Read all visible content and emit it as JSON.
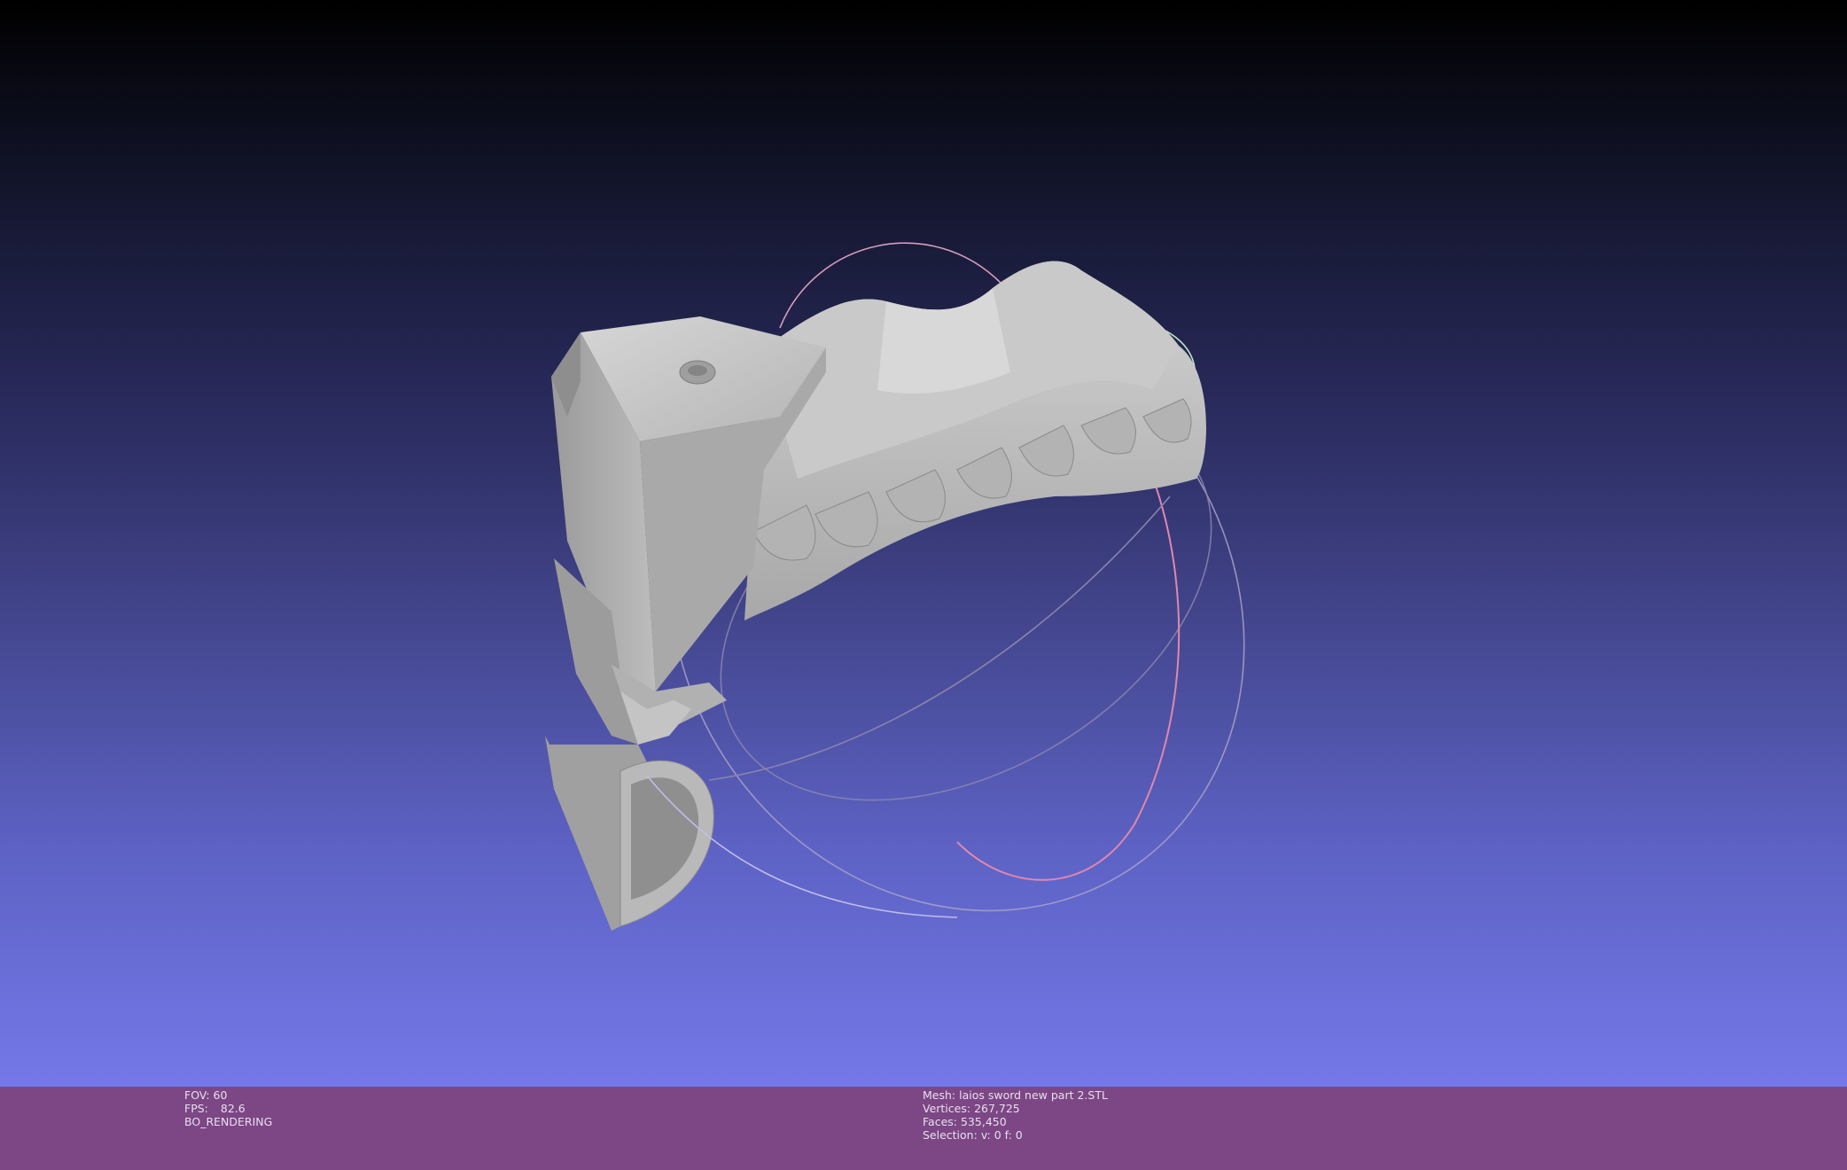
{
  "status": {
    "left": {
      "fov_label": "FOV:",
      "fov_value": "60",
      "fps_label": "FPS:",
      "fps_value": "82.6",
      "render_mode": "BO_RENDERING"
    },
    "right": {
      "mesh_label": "Mesh:",
      "mesh_name": "laios sword new part 2.STL",
      "vertices_label": "Vertices:",
      "vertices_value": "267,725",
      "faces_label": "Faces:",
      "faces_value": "535,450",
      "selection_label": "Selection:",
      "selection_value": "v: 0 f: 0"
    }
  },
  "viewport": {
    "background_top": "#000000",
    "background_bottom": "#7478e8",
    "mesh_color": "#b8b8b8",
    "trackball_colors": {
      "x": "#e87fa8",
      "y": "#9fe8a0",
      "z": "#b8b8e8"
    }
  }
}
